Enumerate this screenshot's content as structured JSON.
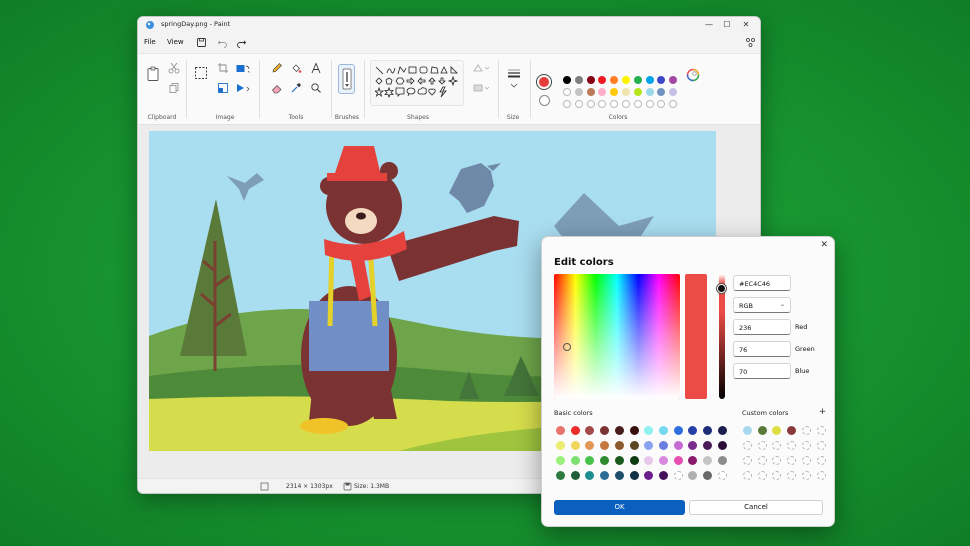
{
  "window": {
    "title": "springDay.png - Paint",
    "controls": {
      "minimize": "—",
      "maximize": "☐",
      "close": "✕"
    }
  },
  "menu": {
    "file": "File",
    "view": "View"
  },
  "ribbon": {
    "groups": {
      "clipboard": "Clipboard",
      "image": "Image",
      "tools": "Tools",
      "brushes": "Brushes",
      "shapes": "Shapes",
      "size": "Size",
      "colors": "Colors"
    },
    "palette_row1": [
      "#000000",
      "#7f7f7f",
      "#880015",
      "#ed1c24",
      "#ff7f27",
      "#fff200",
      "#22b14c",
      "#00a2e8",
      "#3f48cc",
      "#a349a4"
    ],
    "palette_row2": [
      "#ffffff",
      "#c3c3c3",
      "#b97a57",
      "#ffaec9",
      "#ffc90e",
      "#efe4b0",
      "#b5e61d",
      "#99d9ea",
      "#7092be",
      "#c8bfe7"
    ],
    "color1": "#e63b3b",
    "color2": "#ffffff"
  },
  "status": {
    "dimensions": "2314 × 1303px",
    "size": "Size: 1.3MB"
  },
  "dialog": {
    "title": "Edit colors",
    "close": "✕",
    "hex": "#EC4C46",
    "mode": "RGB",
    "red": {
      "value": "236",
      "label": "Red"
    },
    "green": {
      "value": "76",
      "label": "Green"
    },
    "blue": {
      "value": "70",
      "label": "Blue"
    },
    "basic_label": "Basic colors",
    "custom_label": "Custom colors",
    "add": "+",
    "ok": "OK",
    "cancel": "Cancel",
    "preview_color": "#ec4c46",
    "basic_colors": [
      [
        "#e8736d",
        "#ec2b2b",
        "#a4494a",
        "#7a3233",
        "#4a1d1d",
        "#3a0d0d",
        "#8ff0f0",
        "#73d8f0",
        "#2d6fdf",
        "#243fa8",
        "#1d2d79",
        "#1b1f50"
      ],
      [
        "#ecec70",
        "#f2d65c",
        "#e39754",
        "#c5773d",
        "#8c5a30",
        "#5b4622",
        "#8aa3f0",
        "#6a7de0",
        "#c86ad4",
        "#7a2d8e",
        "#4b1d57",
        "#2c0c38"
      ],
      [
        "#9af07a",
        "#7de070",
        "#47c24a",
        "#2d8a2f",
        "#1a5a1d",
        "#0f3b12",
        "#e8c8ec",
        "#d98ae0",
        "#e64fb0",
        "#8a1a6b",
        "#c4c4c4",
        "#8c8c8c"
      ],
      [
        "#2f7a3f",
        "#1e5f3a",
        "#1b8f8f",
        "#2a6d94",
        "#1d4f6d",
        "#123145",
        "#6b1d8c",
        "#45115c",
        "#ffffff",
        "#b0b0b0",
        "#6a6a6a",
        "#ffffff"
      ]
    ],
    "custom_colors": [
      "#a8d8ee",
      "#5a7a3a",
      "#dede40",
      "#8a3a3a"
    ]
  }
}
